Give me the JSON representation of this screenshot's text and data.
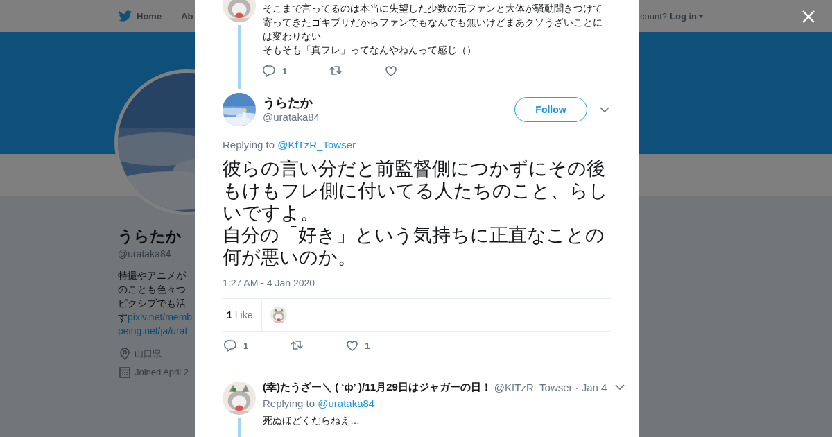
{
  "nav": {
    "items": [
      {
        "label": "Home",
        "kind": "home"
      },
      {
        "label": "Ab",
        "kind": "plain"
      }
    ],
    "account_prompt": "count?",
    "login": "Log in"
  },
  "profile": {
    "name": "うらたか",
    "handle": "@urataka84",
    "bio": [
      {
        "text": "特撮やアニメが"
      },
      {
        "text": "のことも色々つ"
      },
      {
        "text": "ピクシブでも活"
      },
      {
        "text": "す",
        "link": "pixiv.net/memb"
      },
      {
        "link": "peing.net/ja/urat"
      }
    ],
    "location": "山口県",
    "joined": "Joined April 2"
  },
  "previous_tweet": {
    "paragraphs": [
      "そこまで言ってるのは本当に失望した少数の元ファンと大体が騒動聞きつけて寄ってきたゴキブリだからファンでもなんでも無いけどまあクソうざいことには変わりない",
      "そもそも「真フレ」ってなんやねんって感じ（）"
    ],
    "reply_count": "1"
  },
  "tweet": {
    "name": "うらたか",
    "handle": "@urataka84",
    "follow": "Follow",
    "replying_to": "Replying to",
    "mention": "@KfTzR_Towser",
    "paragraphs": [
      "彼らの言い分だと前監督側につかずにその後もけもフレ側に付いてる人たちのこと、らしいですよ。",
      "自分の「好き」という気持ちに正直なことの何が悪いのか。"
    ],
    "time": "1:27 AM - 4 Jan 2020",
    "like_count": "1",
    "like_label": "Like",
    "reply_count": "1",
    "fav_count": "1"
  },
  "reply": {
    "name": "(幸)たうざー＼ ( ‘ф’ )/11月29日はジャガーの日！",
    "handle": "@KfTzR_Towser",
    "date": "· Jan 4",
    "replying_to": "Replying to",
    "mention": "@urataka84",
    "text": "死ぬほどくだらねえ…"
  }
}
